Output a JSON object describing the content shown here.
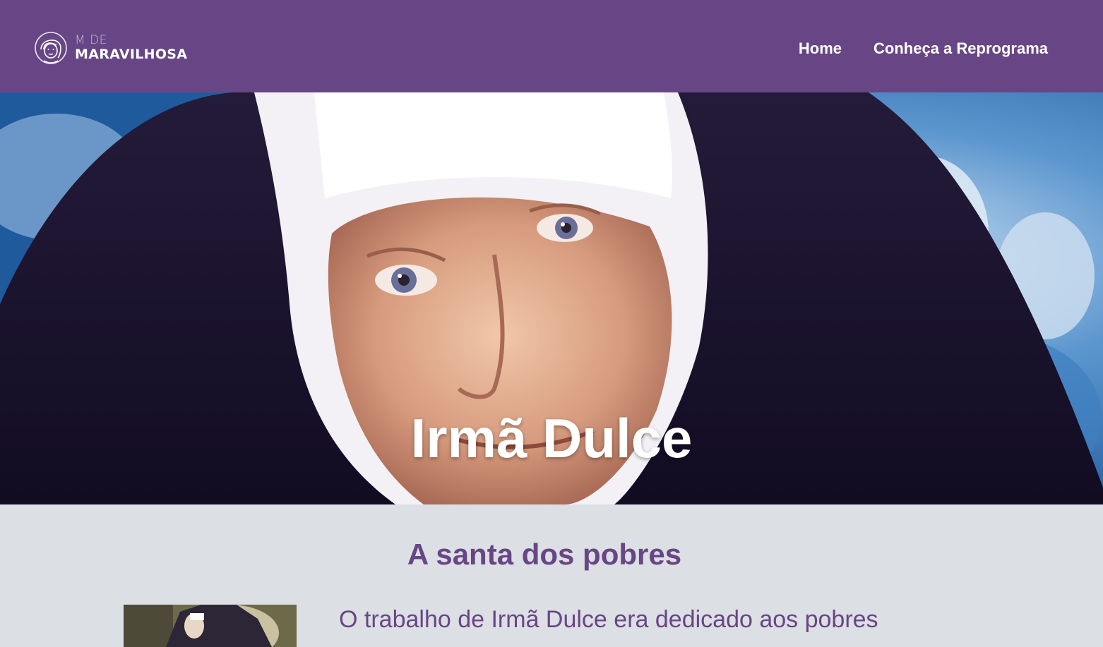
{
  "header": {
    "logo": {
      "icon": "woman-face-icon",
      "small_text": "M DE",
      "big_text": "MARAVILHOSA"
    },
    "nav": [
      {
        "label": "Home"
      },
      {
        "label": "Conheça a Reprograma"
      }
    ],
    "background_color": "#684686"
  },
  "hero": {
    "title": "Irmã Dulce",
    "image": "portrait-of-nun"
  },
  "main": {
    "section_title": "A santa dos pobres",
    "paragraph": "O trabalho de Irmã Dulce era dedicado aos pobres",
    "thumbnail": "nun-photo-thumbnail"
  },
  "colors": {
    "accent": "#684686",
    "background": "#dcdfe3",
    "hero_text": "#ffffff"
  }
}
